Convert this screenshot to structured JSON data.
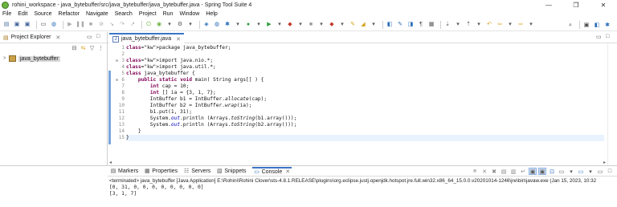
{
  "window": {
    "title": "rohini_workspace - java_bytebuffer/src/java_bytebuffer/java_bytebuffer.java - Spring Tool Suite 4",
    "minimize": "—",
    "maximize": "❐",
    "close": "✕"
  },
  "menu": [
    "File",
    "Edit",
    "Source",
    "Refactor",
    "Navigate",
    "Search",
    "Project",
    "Run",
    "Window",
    "Help"
  ],
  "project_explorer": {
    "tab_label": "Project Explorer",
    "close_glyph": "✕",
    "minimize_glyph": "▭",
    "maximize_glyph": "□",
    "tree": [
      {
        "label": "java_bytebuffer",
        "expanded": false
      }
    ]
  },
  "editor": {
    "tab_label": "java_bytebuffer.java",
    "tab_close": "✕",
    "lines": [
      {
        "n": "1",
        "text": "package java_bytebuffer;"
      },
      {
        "n": "2",
        "text": ""
      },
      {
        "n": "3",
        "text": "import java.nio.*;"
      },
      {
        "n": "4",
        "text": "import java.util.*;"
      },
      {
        "n": "5",
        "text": "class java_bytebuffer {"
      },
      {
        "n": "6",
        "text": "    public static void main( String args[] ) {"
      },
      {
        "n": "7",
        "text": "        int cap = 10;"
      },
      {
        "n": "8",
        "text": "        int [] ia = {3, 1, 7};"
      },
      {
        "n": "9",
        "text": "        IntBuffer b1 = IntBuffer.allocate(cap);"
      },
      {
        "n": "10",
        "text": "        IntBuffer b2 = IntBuffer.wrap(ia);"
      },
      {
        "n": "11",
        "text": "        b1.put(1, 31);"
      },
      {
        "n": "12",
        "text": "        System.out.println (Arrays.toString(b1.array()));"
      },
      {
        "n": "13",
        "text": "        System.out.println (Arrays.toString(b2.array()));"
      },
      {
        "n": "14",
        "text": "    }"
      },
      {
        "n": "15",
        "text": "}"
      }
    ]
  },
  "bottom_panel": {
    "tabs": [
      {
        "label": "Markers",
        "icon": "markers-icon",
        "active": false
      },
      {
        "label": "Properties",
        "icon": "properties-icon",
        "active": false
      },
      {
        "label": "Servers",
        "icon": "servers-icon",
        "active": false
      },
      {
        "label": "Snippets",
        "icon": "snippets-icon",
        "active": false
      },
      {
        "label": "Console",
        "icon": "console-icon",
        "active": true
      }
    ],
    "console_close": "✕",
    "console_header": "<terminated> java_bytebuffer [Java Application] E:\\Rohini\\Rohini Clover\\sts-4.8.1.RELEASE\\plugins\\org.eclipse.justj.openjdk.hotspot.jre.full.win32.x86_64_15.0.0.v20201014-1246\\jre\\bin\\javaw.exe (Jan 15, 2023, 10:32",
    "output": [
      "[0, 31, 0, 0, 0, 0, 0, 0, 0, 0]",
      "[3, 1, 7]"
    ]
  },
  "colors": {
    "keyword": "#7f0055",
    "static_field": "#0000c0",
    "accent": "#3b75c6",
    "spring_green": "#6db33f"
  }
}
